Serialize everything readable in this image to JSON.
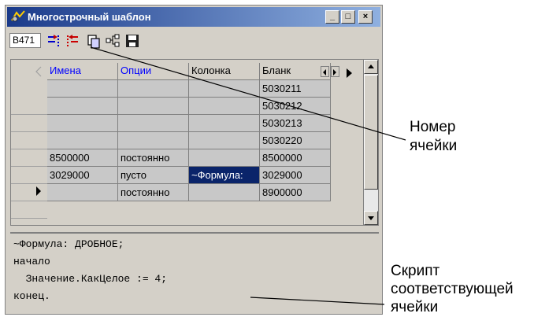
{
  "window": {
    "title": "Многострочный шаблон",
    "controls": {
      "minimize": "_",
      "maximize": "□",
      "close": "×"
    }
  },
  "toolbar": {
    "cell_id": "B471",
    "tools": [
      "insert-row-icon",
      "delete-row-icon",
      "copy-icon",
      "tree-icon",
      "save-icon"
    ]
  },
  "grid": {
    "columns": [
      "Имена",
      "Опции",
      "Колонка",
      "Бланк"
    ],
    "rows": [
      [
        "",
        "",
        "",
        "5030211"
      ],
      [
        "",
        "",
        "",
        "5030212"
      ],
      [
        "",
        "",
        "",
        "5030213"
      ],
      [
        "",
        "",
        "",
        "5030220"
      ],
      [
        "8500000",
        "постоянно",
        "",
        "8500000"
      ],
      [
        "3029000",
        "пусто",
        "~Формула:",
        "3029000"
      ],
      [
        "",
        "постоянно",
        "",
        "8900000"
      ]
    ],
    "current_row_index": 5,
    "selected_cell": "~Формула:"
  },
  "script": {
    "lines": [
      "~Формула: ДРОБНОЕ;",
      "начало",
      "  Значение.КакЦелое := 4;",
      "конец."
    ]
  },
  "annotations": {
    "cell_number": [
      "Номер",
      "ячейки"
    ],
    "cell_script": [
      "Скрипт",
      "соответствующей",
      "ячейки"
    ]
  }
}
